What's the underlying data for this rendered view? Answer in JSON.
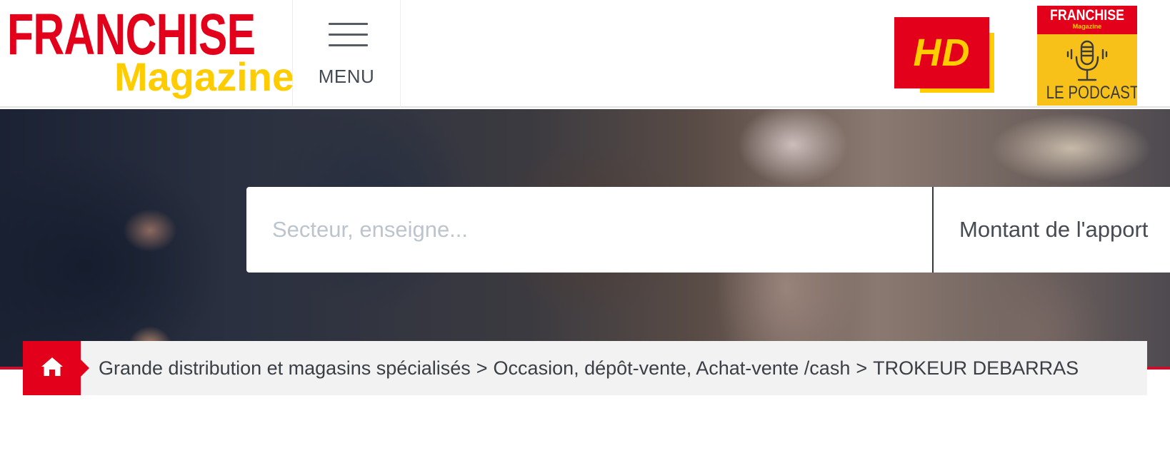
{
  "header": {
    "logo": {
      "line1": "FRANCHISE",
      "line2": "Magazine"
    },
    "menu_label": "MENU",
    "hd_badge": "HD",
    "podcast": {
      "brand": "FRANCHISE",
      "brand_sub": "Magazine",
      "label": "LE PODCAST"
    }
  },
  "search": {
    "placeholder": "Secteur, enseigne...",
    "apport_label": "Montant de l'apport"
  },
  "breadcrumb": {
    "items": [
      "Grande distribution et magasins spécialisés",
      "Occasion, dépôt-vente, Achat-vente /cash"
    ],
    "current": "TROKEUR DEBARRAS",
    "separator": ">"
  },
  "colors": {
    "brand_red": "#e2001a",
    "brand_yellow": "#ffcc00",
    "podcast_yellow": "#f7c11a",
    "breadcrumb_bg": "#f2f2f2",
    "text_dark": "#3a3f45",
    "placeholder": "#bcc4cc"
  },
  "icons": {
    "menu": "hamburger-icon",
    "home": "home-icon",
    "podcast": "microphone-icon"
  }
}
